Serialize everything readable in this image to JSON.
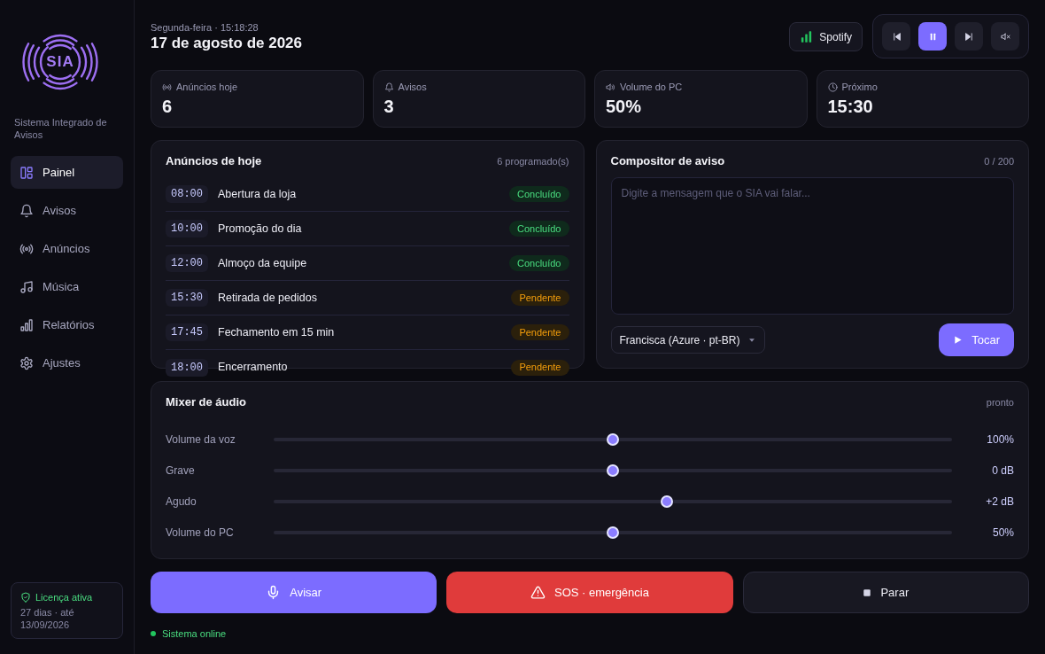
{
  "sidebar": {
    "logo_text": "SIA",
    "subtitle": "Sistema Integrado de Avisos",
    "nav": [
      {
        "label": "Painel",
        "selected": true
      },
      {
        "label": "Avisos",
        "selected": false
      },
      {
        "label": "Anúncios",
        "selected": false
      },
      {
        "label": "Música",
        "selected": false
      },
      {
        "label": "Relatórios",
        "selected": false
      },
      {
        "label": "Ajustes",
        "selected": false
      }
    ],
    "license": {
      "title": "Licença ativa",
      "detail": "27 dias · até 13/09/2026"
    }
  },
  "header": {
    "datetime": "Segunda-feira · 15:18:28",
    "date": "17 de agosto de 2026",
    "source_button": "Spotify",
    "media_controls": [
      {
        "selected": false
      },
      {
        "selected": true
      },
      {
        "selected": false
      },
      {
        "selected": false
      }
    ]
  },
  "stats": [
    {
      "label": "Anúncios hoje",
      "value": "6"
    },
    {
      "label": "Avisos",
      "value": "3"
    },
    {
      "label": "Volume do PC",
      "value": "50%"
    },
    {
      "label": "Próximo",
      "value": "15:30"
    }
  ],
  "announcements": {
    "title": "Anúncios de hoje",
    "count": "6 programado(s)",
    "items": [
      {
        "time": "08:00",
        "title": "Abertura da loja",
        "status": "Concluído",
        "kind": "done"
      },
      {
        "time": "10:00",
        "title": "Promoção do dia",
        "status": "Concluído",
        "kind": "done"
      },
      {
        "time": "12:00",
        "title": "Almoço da equipe",
        "status": "Concluído",
        "kind": "done"
      },
      {
        "time": "15:30",
        "title": "Retirada de pedidos",
        "status": "Pendente",
        "kind": "pending"
      },
      {
        "time": "17:45",
        "title": "Fechamento em 15 min",
        "status": "Pendente",
        "kind": "pending"
      },
      {
        "time": "18:00",
        "title": "Encerramento",
        "status": "Pendente",
        "kind": "pending"
      }
    ]
  },
  "composer": {
    "title": "Compositor de aviso",
    "counter": "0 / 200",
    "message": {
      "placeholder": "Digite a mensagem que o SIA vai falar..."
    },
    "voice": "Francisca (Azure · pt-BR)",
    "play_button": "Tocar"
  },
  "mixer": {
    "title": "Mixer de áudio",
    "status": "pronto",
    "channels": [
      {
        "name": "Volume da voz",
        "level": 0.5,
        "reading": "100%"
      },
      {
        "name": "Grave",
        "level": 0.5,
        "reading": "0 dB"
      },
      {
        "name": "Agudo",
        "level": 0.58,
        "reading": "+2 dB"
      },
      {
        "name": "Volume do PC",
        "level": 0.5,
        "reading": "50%"
      }
    ]
  },
  "actions": [
    {
      "label": "Avisar",
      "kind": "primary"
    },
    {
      "label": "SOS · emergência",
      "kind": "danger"
    },
    {
      "label": "Parar",
      "kind": "secondary"
    }
  ],
  "status_bar": {
    "text": "Sistema online",
    "online": true
  }
}
